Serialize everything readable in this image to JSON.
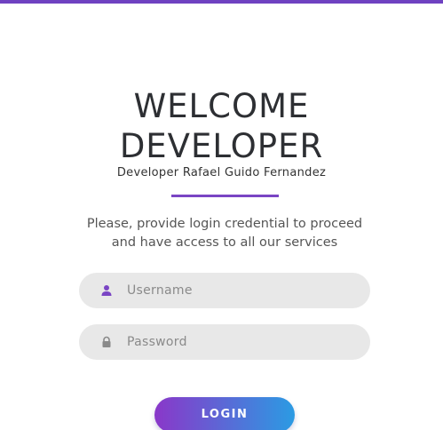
{
  "header": {
    "title_line1": "WELCOME",
    "title_line2": "DEVELOPER",
    "subtitle": "Developer Rafael Guido Fernandez"
  },
  "intro": {
    "line1": "Please, provide login credential to proceed",
    "line2": "and have access to all our services"
  },
  "form": {
    "username_placeholder": "Username",
    "username_value": "",
    "password_placeholder": "Password",
    "password_value": "",
    "username_icon": "user-icon",
    "password_icon": "lock-icon",
    "login_label": "LOGIN"
  },
  "colors": {
    "accent": "#6f42c1",
    "button_gradient_start": "#8a37c9",
    "button_gradient_end": "#2b9be3",
    "input_background": "#e8e8e8"
  }
}
